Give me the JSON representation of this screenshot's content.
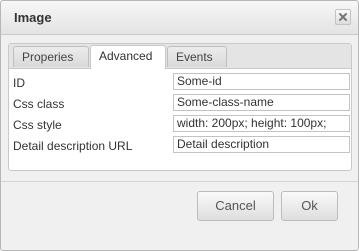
{
  "dialog": {
    "title": "Image",
    "close_icon": "close-x-icon"
  },
  "tabs": [
    {
      "label": "Properies",
      "active": false
    },
    {
      "label": "Advanced",
      "active": true
    },
    {
      "label": "Events",
      "active": false
    }
  ],
  "fields": [
    {
      "label": "ID",
      "value": "Some-id"
    },
    {
      "label": "Css class",
      "value": "Some-class-name"
    },
    {
      "label": "Css style",
      "value": "width: 200px; height: 100px;"
    },
    {
      "label": "Detail description URL",
      "value": "Detail description"
    }
  ],
  "buttons": {
    "cancel": "Cancel",
    "ok": "Ok"
  },
  "colors": {
    "dialog_bg": "#f0f0f0",
    "panel_bg": "#ffffff",
    "border": "#c9c9c9"
  }
}
